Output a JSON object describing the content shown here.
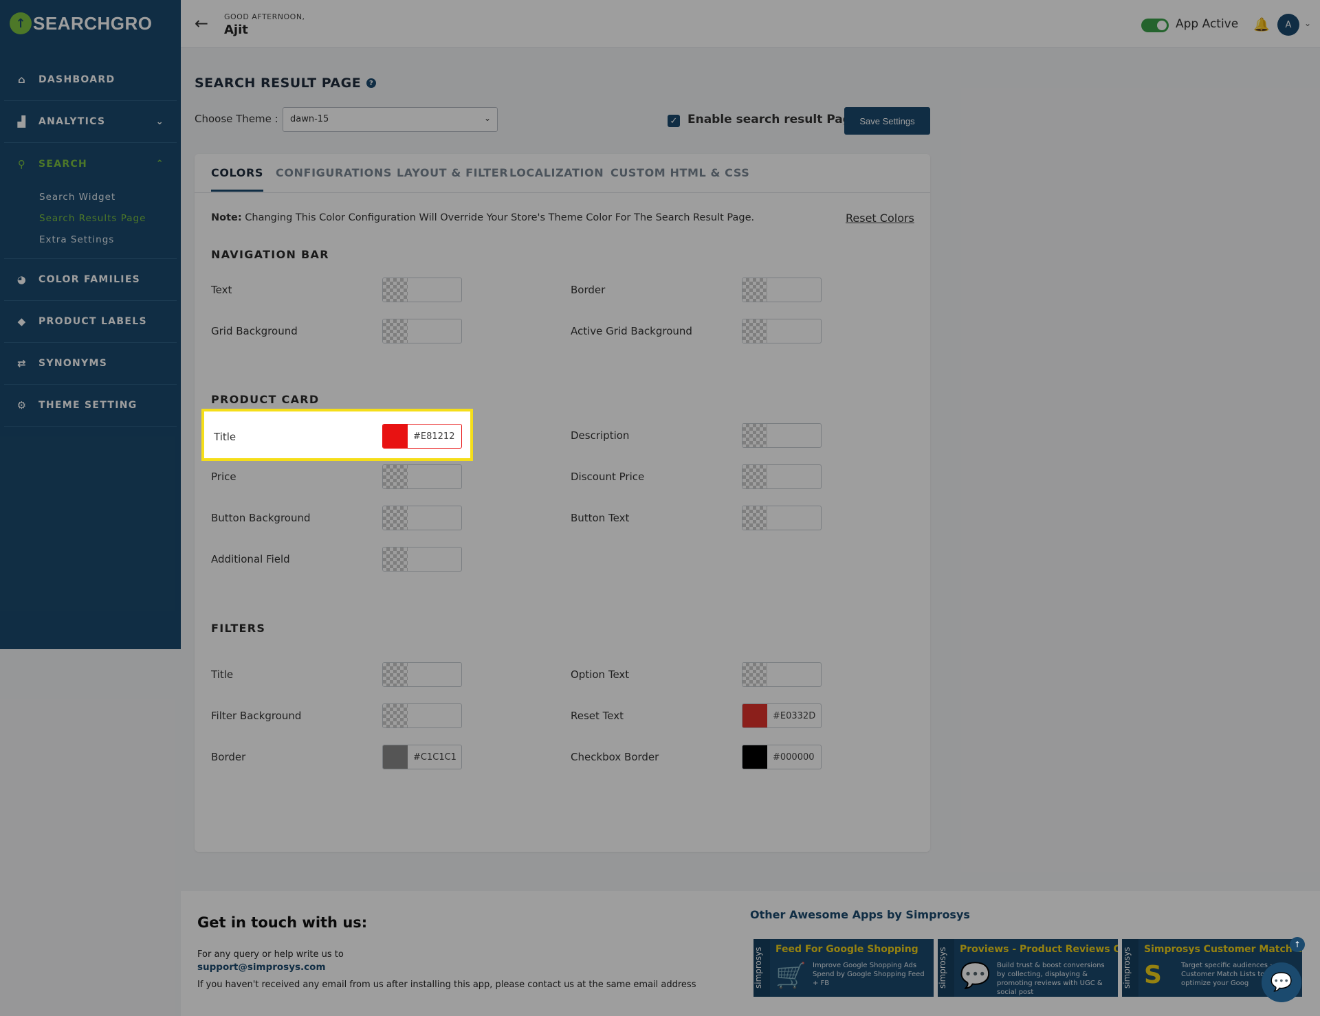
{
  "app": {
    "logo_text": "SEARCHGRO",
    "logo_mark": "↑"
  },
  "sidebar": {
    "items": [
      {
        "label": "DASHBOARD",
        "icon": "home-icon",
        "glyph": "⌂"
      },
      {
        "label": "ANALYTICS",
        "icon": "bar-chart-icon",
        "glyph": "▟",
        "chevron": "⌄"
      },
      {
        "label": "SEARCH",
        "icon": "search-icon",
        "glyph": "⚲",
        "chevron": "⌃"
      },
      {
        "label": "COLOR FAMILIES",
        "icon": "palette-icon",
        "glyph": "◕"
      },
      {
        "label": "PRODUCT LABELS",
        "icon": "tag-icon",
        "glyph": "◆"
      },
      {
        "label": "SYNONYMS",
        "icon": "sync-icon",
        "glyph": "⇄"
      },
      {
        "label": "THEME SETTING",
        "icon": "gear-icon",
        "glyph": "⚙"
      }
    ],
    "search_sub": [
      "Search Widget",
      "Search Results Page",
      "Extra Settings"
    ]
  },
  "topbar": {
    "greeting": "GOOD AFTERNOON,",
    "user_name": "Ajit",
    "app_status": "App Active",
    "avatar_initial": "A"
  },
  "page": {
    "title": "SEARCH RESULT PAGE",
    "theme_label": "Choose Theme :",
    "theme_value": "dawn-15",
    "enable_label": "Enable search result Page",
    "save_label": "Save Settings"
  },
  "tabs": [
    "COLORS",
    "CONFIGURATIONS",
    "LAYOUT & FILTER",
    "LOCALIZATION",
    "CUSTOM HTML & CSS"
  ],
  "note": {
    "prefix": "Note:",
    "text": " Changing This Color Configuration Will Override Your Store's Theme Color For The Search Result Page.",
    "reset": "Reset Colors"
  },
  "sections": {
    "navigation_bar": {
      "title": "NAVIGATION BAR",
      "fields": [
        "Text",
        "Border",
        "Grid Background",
        "Active Grid Background"
      ]
    },
    "product_card": {
      "title": "PRODUCT CARD",
      "fields": [
        "Title",
        "Description",
        "Price",
        "Discount Price",
        "Button Background",
        "Button Text",
        "Additional Field"
      ],
      "title_hex": "#E81212",
      "title_color": "#e81212"
    },
    "filters": {
      "title": "FILTERS",
      "fields": [
        "Title",
        "Option Text",
        "Filter Background",
        "Reset Text",
        "Border",
        "Checkbox Border"
      ],
      "reset_text_hex": "#E0332D",
      "reset_text_color": "#e0332d",
      "border_hex": "#C1C1C1",
      "border_color": "#8a8a8a",
      "checkbox_border_hex": "#000000",
      "checkbox_border_color": "#000000"
    }
  },
  "footer": {
    "title": "Get in touch with us:",
    "line1": "For any query or help write us to",
    "email": "support@simprosys.com",
    "line2": "If you haven't received any email from us after installing this app, please contact us at the same email address",
    "apps_title": "Other Awesome Apps by Simprosys",
    "apps": [
      {
        "brand": "simprosys",
        "title": "Feed For Google Shopping",
        "desc": "Improve Google Shopping Ads Spend by Google Shopping Feed + FB",
        "icon": "cart-icon",
        "glyph": "🛒"
      },
      {
        "brand": "simprosys",
        "title": "Proviews - Product Reviews Q&A",
        "desc": "Build trust & boost conversions by collecting, displaying & promoting reviews with UGC & social post",
        "icon": "chat-bubble-icon",
        "glyph": "💬"
      },
      {
        "brand": "simprosys",
        "title": "Simprosys Customer Match Lis",
        "desc": "Target specific audiences · Customer Match Lists to auto-optimize your Goog",
        "icon": "s-logo-icon",
        "glyph": "S"
      }
    ]
  }
}
